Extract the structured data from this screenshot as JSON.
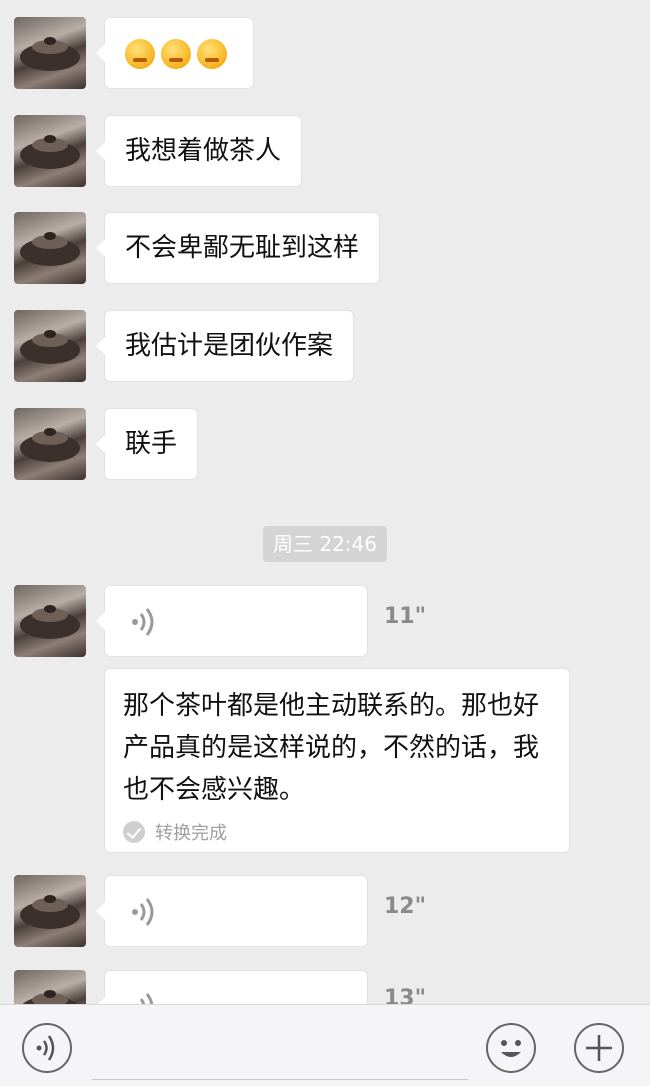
{
  "messages": [
    {
      "type": "emoji"
    },
    {
      "type": "text",
      "text": "我想着做茶人"
    },
    {
      "type": "text",
      "text": "不会卑鄙无耻到这样"
    },
    {
      "type": "text",
      "text": "我估计是团伙作案"
    },
    {
      "type": "text",
      "text": "联手"
    }
  ],
  "timestamp": "周三 22:46",
  "voice_messages": [
    {
      "duration": "11\""
    },
    {
      "duration": "12\""
    },
    {
      "duration": "13\""
    }
  ],
  "transcript": {
    "text": "那个茶叶都是他主动联系的。那也好产品真的是这样说的，不然的话，我也不会感兴趣。",
    "status": "转换完成"
  },
  "toolbar": {
    "voice_icon": "voice-mode-icon",
    "emoji_icon": "emoji-icon",
    "plus_icon": "plus-icon",
    "input_value": ""
  }
}
